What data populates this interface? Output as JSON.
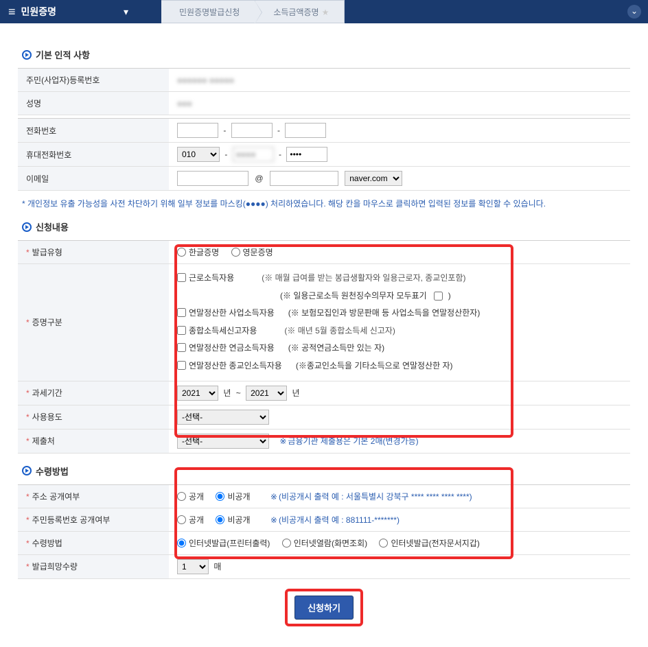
{
  "header": {
    "menu_title": "민원증명",
    "crumb1": "민원증명발급신청",
    "crumb2": "소득금액증명"
  },
  "sections": {
    "s1": "기본 인적 사항",
    "s2": "신청내용",
    "s3": "수령방법"
  },
  "basic": {
    "resident_label": "주민(사업자)등록번호",
    "resident_value": "●●●●●● ●●●●●",
    "name_label": "성명",
    "name_value": "●●●",
    "phone_label": "전화번호",
    "mobile_label": "휴대전화번호",
    "mobile_prefix": "010",
    "mobile_mid": "●●●●",
    "mobile_last": "••••",
    "email_label": "이메일",
    "email_local": "",
    "email_domain_sel": "naver.com"
  },
  "masking_note": "* 개인정보 유출 가능성을 사전 차단하기 위해 일부 정보를 마스킹(●●●●) 처리하였습니다. 해당 칸을 마우스로 클릭하면 입력된 정보를 확인할 수 있습니다.",
  "issue": {
    "type_label": "발급유형",
    "type_kor": "한글증명",
    "type_eng": "영문증명",
    "cert_label": "증명구분",
    "c1": "근로소득자용",
    "c1_note": "(※ 매월 급여를 받는 봉급생활자와 일용근로자, 종교인포함)",
    "c1_sub": "(※ 일용근로소득 원천징수의무자 모두표기",
    "c1_sub_tail": "  )",
    "c2": "연말정산한 사업소득자용",
    "c2_note": "(※ 보험모집인과 방문판매 등 사업소득을 연말정산한자)",
    "c3": "종합소득세신고자용",
    "c3_note": "(※ 매년 5월 종합소득세 신고자)",
    "c4": "연말정산한 연금소득자용",
    "c4_note": "(※ 공적연금소득만 있는 자)",
    "c5": "연말정산한 종교인소득자용",
    "c5_note": "(※종교인소득을 기타소득으로 연말정산한 자)",
    "period_label": "과세기간",
    "year_from": "2021",
    "year_to": "2021",
    "year_unit": "년",
    "year_tilde": "~",
    "purpose_label": "사용용도",
    "purpose_sel": "-선택-",
    "submit_to_label": "제출처",
    "submit_to_sel": "-선택-",
    "submit_to_note": "금융기관 제출용은 기본 2매(변경가능)"
  },
  "delivery": {
    "addr_label": "주소 공개여부",
    "open": "공개",
    "closed": "비공개",
    "addr_hint": "(비공개시 출력 예 : 서울특별시 강북구 **** **** **** ****)",
    "rrn_label": "주민등록번호 공개여부",
    "rrn_hint": "(비공개시 출력 예 : 881111-*******)",
    "method_label": "수령방법",
    "m1": "인터넷발급(프린터출력)",
    "m2": "인터넷열람(화면조회)",
    "m3": "인터넷발급(전자문서지갑)",
    "qty_label": "발급희망수량",
    "qty_val": "1",
    "qty_unit": "매"
  },
  "submit_label": "신청하기"
}
